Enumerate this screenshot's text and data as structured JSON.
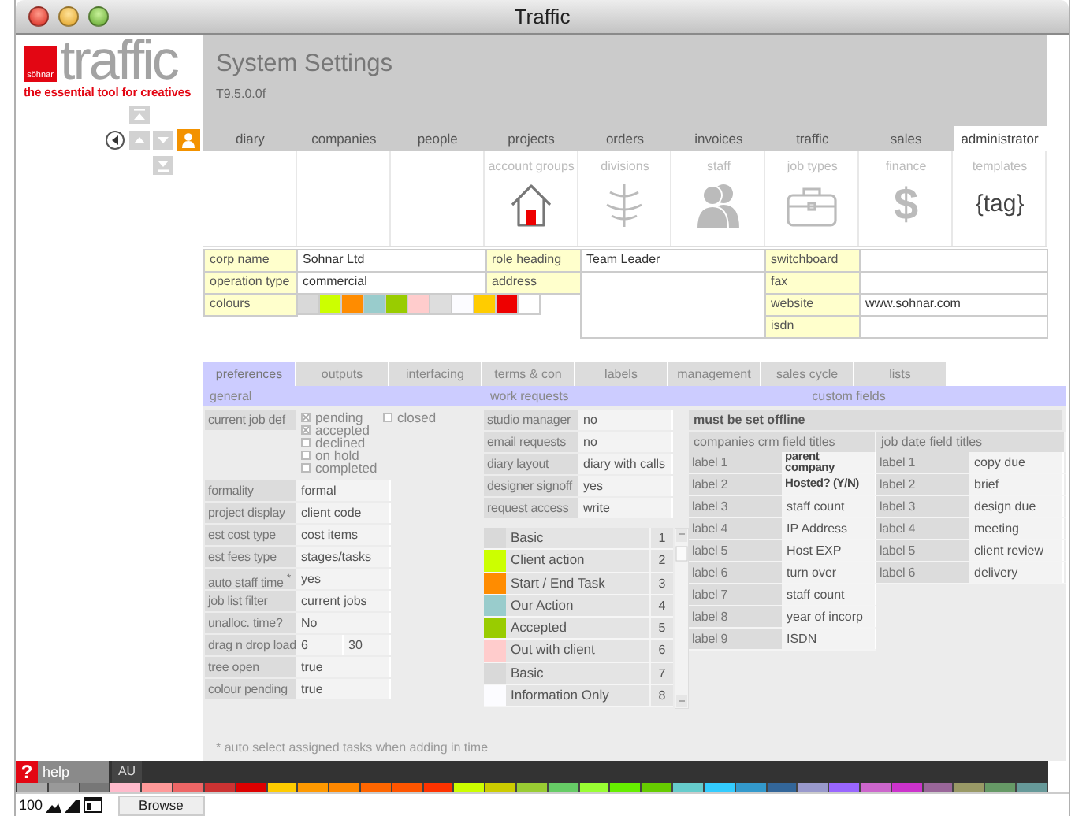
{
  "window": {
    "title": "Traffic"
  },
  "brand": {
    "mark": "söhnar",
    "name": "traffic",
    "tagline": "the essential tool for creatives"
  },
  "header": {
    "title": "System Settings",
    "version": "T9.5.0.0f"
  },
  "tabs": [
    {
      "label": "diary",
      "selected": false
    },
    {
      "label": "companies",
      "selected": false
    },
    {
      "label": "people",
      "selected": false
    },
    {
      "label": "projects",
      "selected": false
    },
    {
      "label": "orders",
      "selected": false
    },
    {
      "label": "invoices",
      "selected": false
    },
    {
      "label": "traffic",
      "selected": false
    },
    {
      "label": "sales",
      "selected": false
    },
    {
      "label": "administrator",
      "selected": true
    }
  ],
  "modules": [
    {
      "label": "account groups",
      "kind": "house",
      "enabled": true
    },
    {
      "label": "divisions",
      "kind": "tree",
      "enabled": false
    },
    {
      "label": "staff",
      "kind": "people",
      "enabled": false
    },
    {
      "label": "job types",
      "kind": "briefcase",
      "enabled": false
    },
    {
      "label": "finance",
      "kind": "glyph",
      "glyph": "$",
      "enabled": false
    },
    {
      "label": "templates",
      "kind": "glyph",
      "glyph": "{tag}",
      "enabled": true
    }
  ],
  "corp": {
    "left": [
      {
        "label": "corp name",
        "kind": "text",
        "value": "Sohnar Ltd"
      },
      {
        "label": "operation type",
        "kind": "text",
        "value": "commercial"
      },
      {
        "label": "colours",
        "kind": "swatches",
        "colours": [
          {
            "color": "#d9d9d9"
          },
          {
            "color": "#ccff00"
          },
          {
            "color": "#ff8c00"
          },
          {
            "color": "#99cccc"
          },
          {
            "color": "#99cc00"
          },
          {
            "color": "#ffcccc"
          },
          {
            "color": "#dddddd"
          },
          {
            "color": "#fcfcff"
          },
          {
            "color": "#ffcc00"
          },
          {
            "color": "#ee0000"
          },
          {
            "color": "#ffffff"
          }
        ]
      }
    ],
    "middle": [
      {
        "label": "role heading",
        "kind": "text",
        "value": "Team Leader"
      },
      {
        "label": "address",
        "kind": "area"
      }
    ],
    "right": [
      {
        "label": "switchboard",
        "kind": "text"
      },
      {
        "label": "fax",
        "kind": "text"
      },
      {
        "label": "website",
        "kind": "text",
        "value": "www.sohnar.com"
      },
      {
        "label": "isdn",
        "kind": "text"
      }
    ]
  },
  "subtabs": [
    {
      "label": "preferences",
      "selected": true
    },
    {
      "label": "outputs",
      "selected": false
    },
    {
      "label": "interfacing",
      "selected": false
    },
    {
      "label": "terms & con",
      "selected": false
    },
    {
      "label": "labels",
      "selected": false
    },
    {
      "label": "management",
      "selected": false
    },
    {
      "label": "sales cycle",
      "selected": false
    },
    {
      "label": "lists",
      "selected": false
    }
  ],
  "sections": {
    "general": "general",
    "work_requests": "work requests",
    "custom_fields": "custom fields"
  },
  "job_def": {
    "label": "current job def",
    "options": [
      {
        "label": "pending",
        "checked": true
      },
      {
        "label": "accepted",
        "checked": true
      },
      {
        "label": "declined",
        "checked": false
      },
      {
        "label": "on hold",
        "checked": false
      },
      {
        "label": "completed",
        "checked": false
      },
      {
        "label": "closed",
        "checked": false
      }
    ]
  },
  "preferences": [
    {
      "label": "formality",
      "values": [
        "formal"
      ]
    },
    {
      "label": "project display",
      "values": [
        "client code"
      ]
    },
    {
      "label": "est cost type",
      "values": [
        "cost items"
      ]
    },
    {
      "label": "est fees type",
      "values": [
        "stages/tasks"
      ]
    },
    {
      "label": "auto staff time $^{*}$",
      "values": [
        "yes"
      ]
    },
    {
      "label": "job list filter",
      "values": [
        "current jobs"
      ]
    },
    {
      "label": "unalloc. time?",
      "values": [
        "No"
      ]
    },
    {
      "label": "drag n drop load",
      "values": [
        "6",
        "30"
      ]
    },
    {
      "label": "tree open",
      "values": [
        "true"
      ]
    },
    {
      "label": "colour pending",
      "values": [
        "true"
      ]
    }
  ],
  "work_requests": [
    {
      "label": "studio manager",
      "value": "no"
    },
    {
      "label": "email requests",
      "value": "no"
    },
    {
      "label": "diary layout",
      "value": "diary with calls"
    },
    {
      "label": "designer signoff",
      "value": "yes"
    },
    {
      "label": "request access",
      "value": "write"
    }
  ],
  "status_colours": [
    {
      "label": "Basic",
      "number": "1",
      "color": "#d9d9d9"
    },
    {
      "label": "Client action",
      "number": "2",
      "color": "#ccff00"
    },
    {
      "label": "Start / End Task",
      "number": "3",
      "color": "#ff8c00"
    },
    {
      "label": "Our Action",
      "number": "4",
      "color": "#99cccc"
    },
    {
      "label": "Accepted",
      "number": "5",
      "color": "#99cc00"
    },
    {
      "label": "Out with client",
      "number": "6",
      "color": "#ffcccc"
    },
    {
      "label": "Basic",
      "number": "7",
      "color": "#d9d9d9"
    },
    {
      "label": "Information Only",
      "number": "8",
      "color": "#fcfcff"
    }
  ],
  "custom_fields": {
    "notice": "must be set offline",
    "crm": {
      "title": "companies crm field titles",
      "labels": [
        {
          "label": "label 1",
          "value": "parent company",
          "bold": true
        },
        {
          "label": "label 2",
          "value": "Hosted? (Y/N)",
          "bold": true
        },
        {
          "label": "label 3",
          "value": "staff count",
          "bold": false
        },
        {
          "label": "label 4",
          "value": "IP Address",
          "bold": false
        },
        {
          "label": "label 5",
          "value": "Host EXP",
          "bold": false
        },
        {
          "label": "label 6",
          "value": "turn over",
          "bold": false
        },
        {
          "label": "label 7",
          "value": "staff count",
          "bold": false
        },
        {
          "label": "label 8",
          "value": "year of incorp",
          "bold": false
        },
        {
          "label": "label 9",
          "value": "ISDN",
          "bold": false
        }
      ]
    },
    "job_dates": {
      "title": "job date field titles",
      "labels": [
        {
          "label": "label 1",
          "value": "copy due"
        },
        {
          "label": "label 2",
          "value": "brief"
        },
        {
          "label": "label 3",
          "value": "design due"
        },
        {
          "label": "label 4",
          "value": "meeting"
        },
        {
          "label": "label 5",
          "value": "client review"
        },
        {
          "label": "label 6",
          "value": "delivery"
        }
      ]
    }
  },
  "footnote": "* auto select assigned tasks when adding in time",
  "footer": {
    "help_icon": "?",
    "help": "help",
    "region": "AU",
    "zoom": "100",
    "mode": "Browse",
    "palette": [
      {
        "color": "#aaaaaa"
      },
      {
        "color": "#999999"
      },
      {
        "color": "#777777"
      },
      {
        "color": "#ffbbcc"
      },
      {
        "color": "#ff9999"
      },
      {
        "color": "#ee6666"
      },
      {
        "color": "#cc3333"
      },
      {
        "color": "#dd0000"
      },
      {
        "color": "#ffcc00"
      },
      {
        "color": "#ff9900"
      },
      {
        "color": "#ff8800"
      },
      {
        "color": "#ff6600"
      },
      {
        "color": "#ff5500"
      },
      {
        "color": "#ff3300"
      },
      {
        "color": "#ccff00"
      },
      {
        "color": "#cccc00"
      },
      {
        "color": "#99cc33"
      },
      {
        "color": "#66cc66"
      },
      {
        "color": "#99ff33"
      },
      {
        "color": "#66ee00"
      },
      {
        "color": "#66cc00"
      },
      {
        "color": "#66cccc"
      },
      {
        "color": "#33ccff"
      },
      {
        "color": "#3399cc"
      },
      {
        "color": "#336699"
      },
      {
        "color": "#9999cc"
      },
      {
        "color": "#9966ff"
      },
      {
        "color": "#cc66cc"
      },
      {
        "color": "#cc33cc"
      },
      {
        "color": "#996699"
      },
      {
        "color": "#999966"
      },
      {
        "color": "#669966"
      },
      {
        "color": "#669999"
      }
    ]
  }
}
